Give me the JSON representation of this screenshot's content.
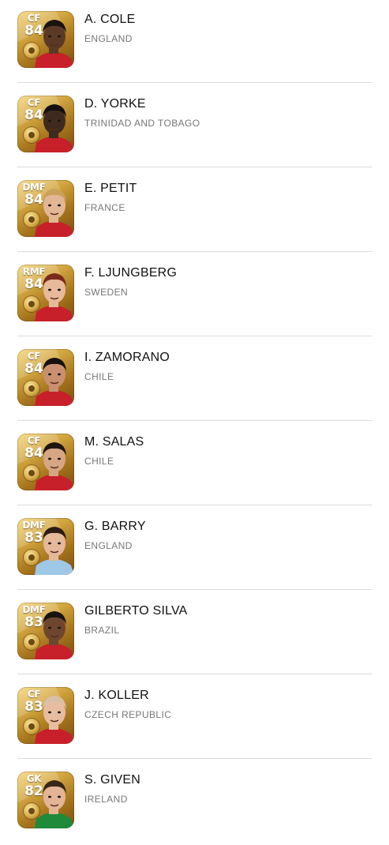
{
  "players": [
    {
      "position": "CF",
      "rating": "84",
      "name": "A. COLE",
      "nation": "ENGLAND",
      "skin": "#5a3a26",
      "hair": "#1a1410",
      "kit": "#c8202a"
    },
    {
      "position": "CF",
      "rating": "84",
      "name": "D. YORKE",
      "nation": "TRINIDAD AND TOBAGO",
      "skin": "#3e2a1e",
      "hair": "#151010",
      "kit": "#c8202a"
    },
    {
      "position": "DMF",
      "rating": "84",
      "name": "E. PETIT",
      "nation": "FRANCE",
      "skin": "#e2b796",
      "hair": "#c9a15a",
      "kit": "#c8202a"
    },
    {
      "position": "RMF",
      "rating": "84",
      "name": "F. LJUNGBERG",
      "nation": "SWEDEN",
      "skin": "#e8b99a",
      "hair": "#7a2a1a",
      "kit": "#c8202a"
    },
    {
      "position": "CF",
      "rating": "84",
      "name": "I. ZAMORANO",
      "nation": "CHILE",
      "skin": "#c89070",
      "hair": "#161010",
      "kit": "#c8202a"
    },
    {
      "position": "CF",
      "rating": "84",
      "name": "M. SALAS",
      "nation": "CHILE",
      "skin": "#d6a684",
      "hair": "#1e1612",
      "kit": "#c8202a"
    },
    {
      "position": "DMF",
      "rating": "83",
      "name": "G. BARRY",
      "nation": "ENGLAND",
      "skin": "#e4b89a",
      "hair": "#2a1c14",
      "kit": "#9fc7e6"
    },
    {
      "position": "DMF",
      "rating": "83",
      "name": "GILBERTO SILVA",
      "nation": "BRAZIL",
      "skin": "#6e4630",
      "hair": "#1a1210",
      "kit": "#c8202a"
    },
    {
      "position": "CF",
      "rating": "83",
      "name": "J. KOLLER",
      "nation": "CZECH REPUBLIC",
      "skin": "#e6bda0",
      "hair": "#d8c0a8",
      "kit": "#c8202a"
    },
    {
      "position": "GK",
      "rating": "82",
      "name": "S. GIVEN",
      "nation": "IRELAND",
      "skin": "#e4b496",
      "hair": "#3a2618",
      "kit": "#1e8a3a"
    }
  ]
}
